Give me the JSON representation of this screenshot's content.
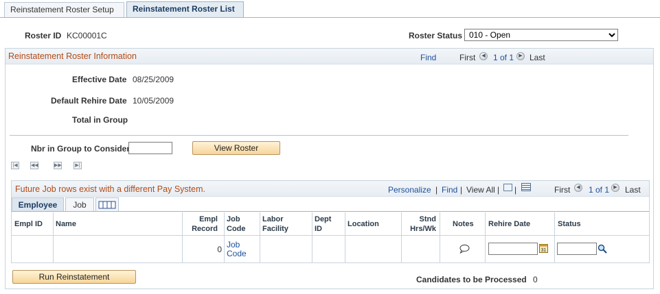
{
  "tabs": [
    {
      "label": "Reinstatement Roster Setup",
      "active": false
    },
    {
      "label": "Reinstatement Roster List",
      "active": true
    }
  ],
  "header": {
    "roster_id_label": "Roster ID",
    "roster_id_value": "KC00001C",
    "roster_status_label": "Roster Status",
    "roster_status_value": "010 - Open"
  },
  "info": {
    "title": "Reinstatement Roster Information",
    "find": "Find",
    "first": "First",
    "count": "1 of 1",
    "last": "Last",
    "effective_date_label": "Effective Date",
    "effective_date_value": "08/25/2009",
    "default_rehire_label": "Default Rehire Date",
    "default_rehire_value": "10/05/2009",
    "total_group_label": "Total in Group",
    "nbr_group_label": "Nbr in Group to Consider",
    "nbr_group_value": "",
    "view_roster_button": "View Roster"
  },
  "grid": {
    "title": "Future Job rows exist with a different Pay System.",
    "personalize": "Personalize",
    "find": "Find",
    "view_all": "View All",
    "first": "First",
    "count": "1 of 1",
    "last": "Last",
    "tabs": [
      "Employee",
      "Job"
    ],
    "columns": {
      "empl_id": "Empl ID",
      "name": "Name",
      "empl_record_1": "Empl",
      "empl_record_2": "Record",
      "job_code_1": "Job",
      "job_code_2": "Code",
      "labor_1": "Labor",
      "labor_2": "Facility",
      "dept_1": "Dept",
      "dept_2": "ID",
      "location": "Location",
      "stnd_1": "Stnd",
      "stnd_2": "Hrs/Wk",
      "notes": "Notes",
      "rehire_date": "Rehire Date",
      "status": "Status"
    },
    "row": {
      "empl_id": "",
      "name": "",
      "empl_record": "0",
      "job_code_1": "Job",
      "job_code_2": "Code",
      "rehire_date": "",
      "status": ""
    }
  },
  "footer": {
    "run_button": "Run Reinstatement",
    "candidates_label": "Candidates to be Processed",
    "candidates_value": "0"
  }
}
